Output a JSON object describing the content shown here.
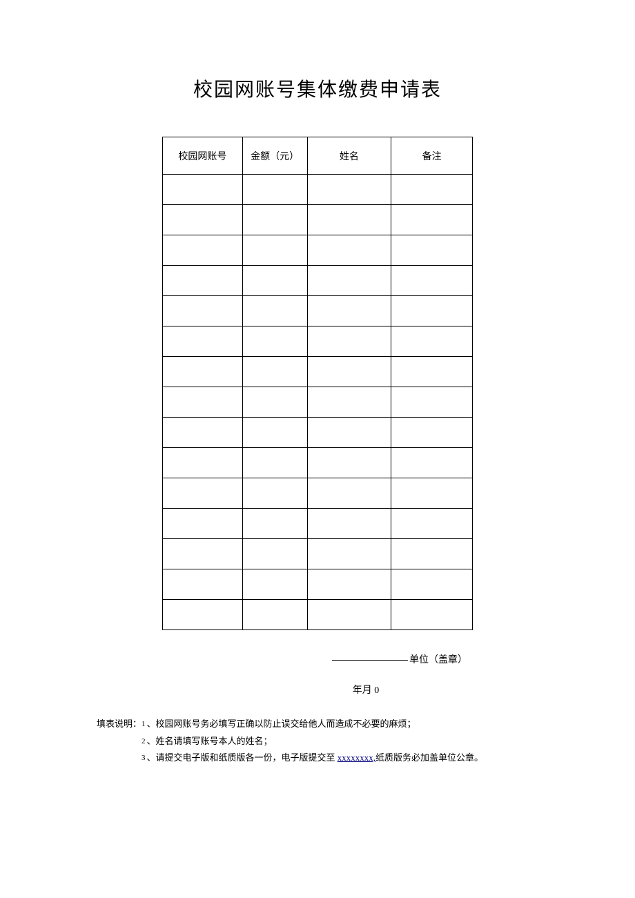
{
  "title": "校园网账号集体缴费申请表",
  "table": {
    "headers": [
      "校园网账号",
      "金额（元）",
      "姓名",
      "备注"
    ],
    "rowCount": 15
  },
  "signature": {
    "label": "单位（盖章）"
  },
  "date": {
    "text": "年月 0"
  },
  "instructions": {
    "prefix": "填表说明：",
    "items": [
      {
        "num": "1",
        "text": "、校园网账号务必填写正确以防止误交给他人而造成不必要的麻烦；"
      },
      {
        "num": "2",
        "text": "、姓名请填写账号本人的姓名；"
      },
      {
        "num": "3",
        "text_before": "、请提交电子版和纸质版各一份，电子版提交至 ",
        "link": "xxxxxxxx,",
        "text_after": "纸质版务必加盖单位公章。"
      }
    ]
  }
}
